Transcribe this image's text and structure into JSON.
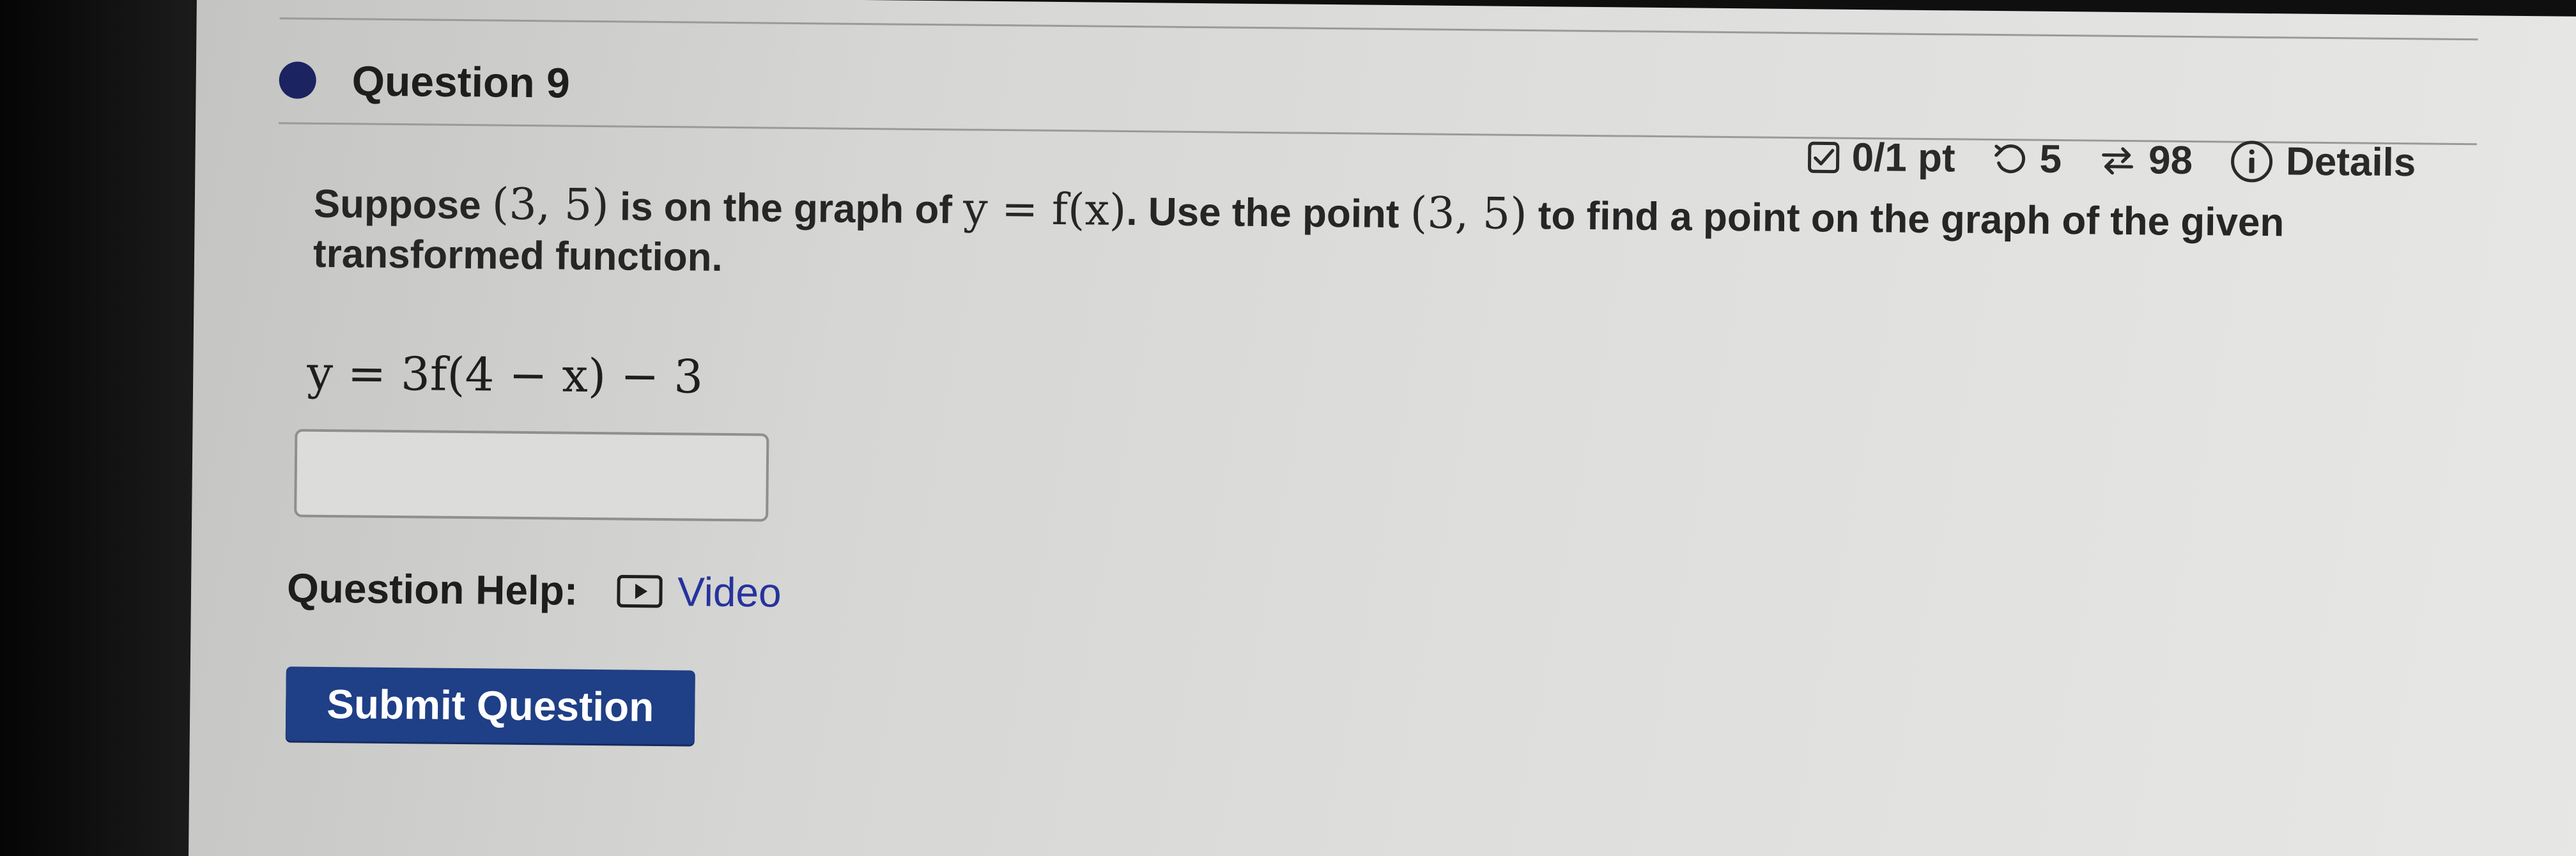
{
  "question": {
    "title": "Question 9"
  },
  "meta": {
    "score": "0/1 pt",
    "retries": "5",
    "attempts": "98",
    "details_label": "Details",
    "icons": [
      "checkbox-icon",
      "retry-icon",
      "attempts-icon",
      "info-icon"
    ]
  },
  "statement": {
    "part1": "Suppose ",
    "point1": "(3, 5)",
    "part2": " is on the graph of ",
    "func": "y = f(x)",
    "part3": ". Use the point ",
    "point2": "(3, 5)",
    "part4": " to find a point on the graph of the given transformed function."
  },
  "equation": "y = 3f(4 − x) − 3",
  "answer": {
    "value": ""
  },
  "help": {
    "label": "Question Help:",
    "video_label": "Video"
  },
  "submit_label": "Submit Question",
  "colors": {
    "accent_dot": "#1b2361",
    "link": "#26339c",
    "submit_bg": "#1f3f86"
  }
}
